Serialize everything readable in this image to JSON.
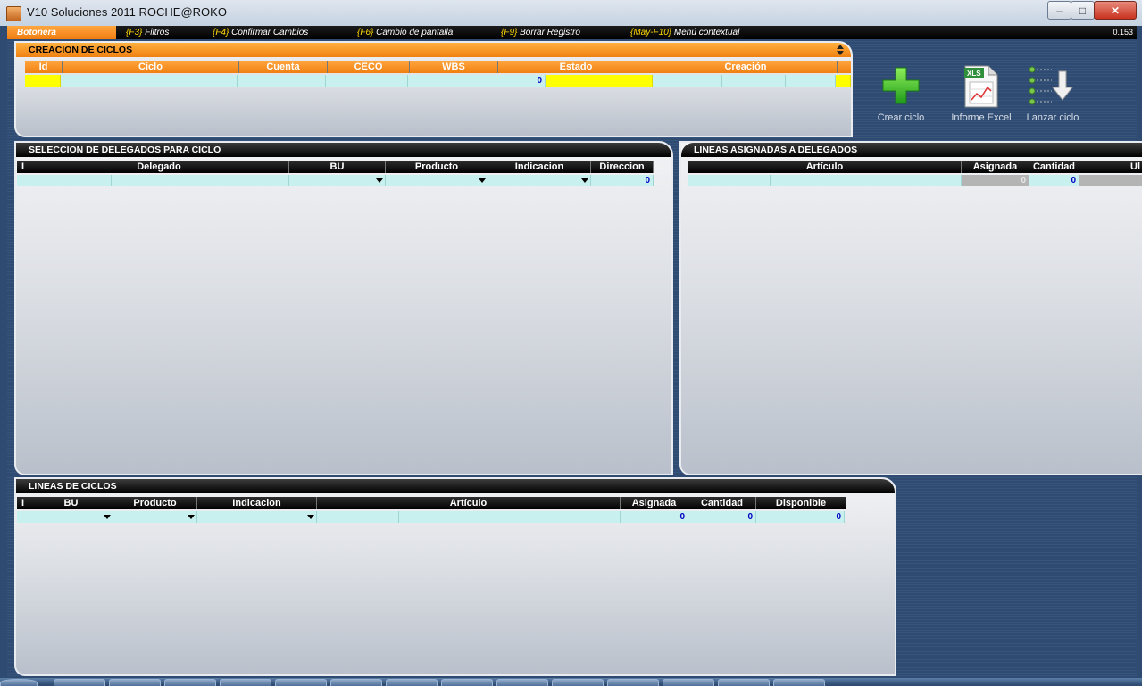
{
  "window": {
    "title": "V10 Soluciones 2011 ROCHE@ROKO",
    "minimize": "–",
    "maximize": "□",
    "close": "✕"
  },
  "fkeys": {
    "botonera": "Botonera",
    "items": [
      {
        "key": "{F3}",
        "label": " Filtros"
      },
      {
        "key": "{F4}",
        "label": " Confirmar Cambios"
      },
      {
        "key": "{F6}",
        "label": " Cambio de pantalla"
      },
      {
        "key": "{F9}",
        "label": " Borrar Registro"
      },
      {
        "key": "{May-F10}",
        "label": " Menú contextual"
      }
    ],
    "version": "0.153"
  },
  "creacion": {
    "title": "CREACION DE CICLOS",
    "columns": [
      "Id",
      "Ciclo",
      "Cuenta",
      "CECO",
      "WBS",
      "Estado",
      "Creación"
    ],
    "row_value": "0"
  },
  "toolbar": {
    "crear": "Crear ciclo",
    "informe": "Informe Excel",
    "lanzar": "Lanzar ciclo",
    "xls_tag": "XLS"
  },
  "delegados": {
    "title": "SELECCION DE DELEGADOS PARA CICLO",
    "columns": [
      "I",
      "Delegado",
      "BU",
      "Producto",
      "Indicacion",
      "Direccion"
    ],
    "row_value": "0"
  },
  "lineas_asignadas": {
    "title": "LINEAS ASIGNADAS A DELEGADOS",
    "columns": [
      "Artículo",
      "Asignada",
      "Cantidad",
      "Ul"
    ],
    "asignada_value": "0",
    "cantidad_value": "0"
  },
  "lineas_ciclos": {
    "title": "LINEAS DE CICLOS",
    "columns": [
      "I",
      "BU",
      "Producto",
      "Indicacion",
      "Artículo",
      "Asignada",
      "Cantidad",
      "Disponible"
    ],
    "asignada_value": "0",
    "cantidad_value": "0",
    "disponible_value": "0"
  },
  "colors": {
    "accent_orange": "#f08010",
    "row_cyan": "#c8f0ef",
    "highlight_yellow": "#ffff00",
    "workspace_blue": "#2f4b72"
  }
}
